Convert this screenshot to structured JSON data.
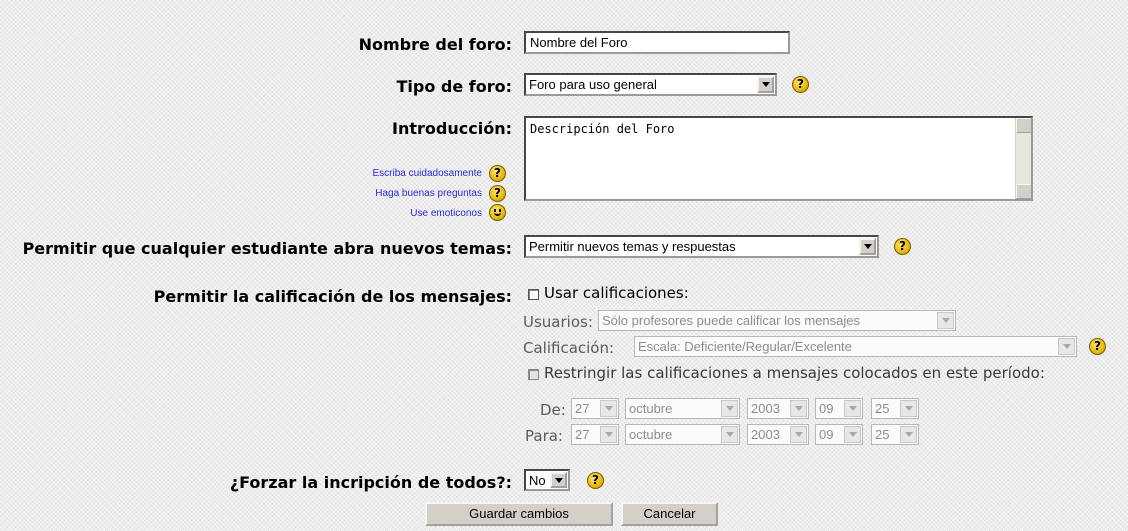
{
  "form": {
    "nombre": {
      "label": "Nombre del foro:",
      "value": "Nombre del Foro"
    },
    "tipo": {
      "label": "Tipo de foro:",
      "value": "Foro para uso general"
    },
    "intro": {
      "label": "Introducción:",
      "value": "Descripción del Foro",
      "links": [
        "Escriba cuidadosamente",
        "Haga buenas preguntas",
        "Use emoticonos"
      ]
    },
    "permitir": {
      "label": "Permitir que cualquier estudiante abra nuevos temas:",
      "value": "Permitir nuevos temas y respuestas"
    },
    "calif": {
      "label": "Permitir la calificación de los mensajes:",
      "checkbox_label": "Usar calificaciones:",
      "usuarios_label": "Usuarios:",
      "usuarios_value": "Sólo profesores puede calificar los mensajes",
      "calificacion_label": "Calificación:",
      "calificacion_value": "Escala: Deficiente/Regular/Excelente",
      "restringir_label": "Restringir las calificaciones a mensajes colocados en este período:",
      "de_label": "De:",
      "para_label": "Para:",
      "de": {
        "day": "27",
        "month": "octubre",
        "year": "2003",
        "hour": "09",
        "minute": "25"
      },
      "para": {
        "day": "27",
        "month": "octubre",
        "year": "2003",
        "hour": "09",
        "minute": "25"
      }
    },
    "forzar": {
      "label": "¿Forzar la incripción de todos?:",
      "value": "No"
    }
  },
  "buttons": {
    "save": "Guardar cambios",
    "cancel": "Cancelar"
  },
  "icons": {
    "help": "?",
    "help_icon": "help-icon",
    "smiley_icon": "smiley-icon"
  },
  "colors": {
    "link": "#2a2ad8",
    "help_icon": "#e0b000"
  }
}
